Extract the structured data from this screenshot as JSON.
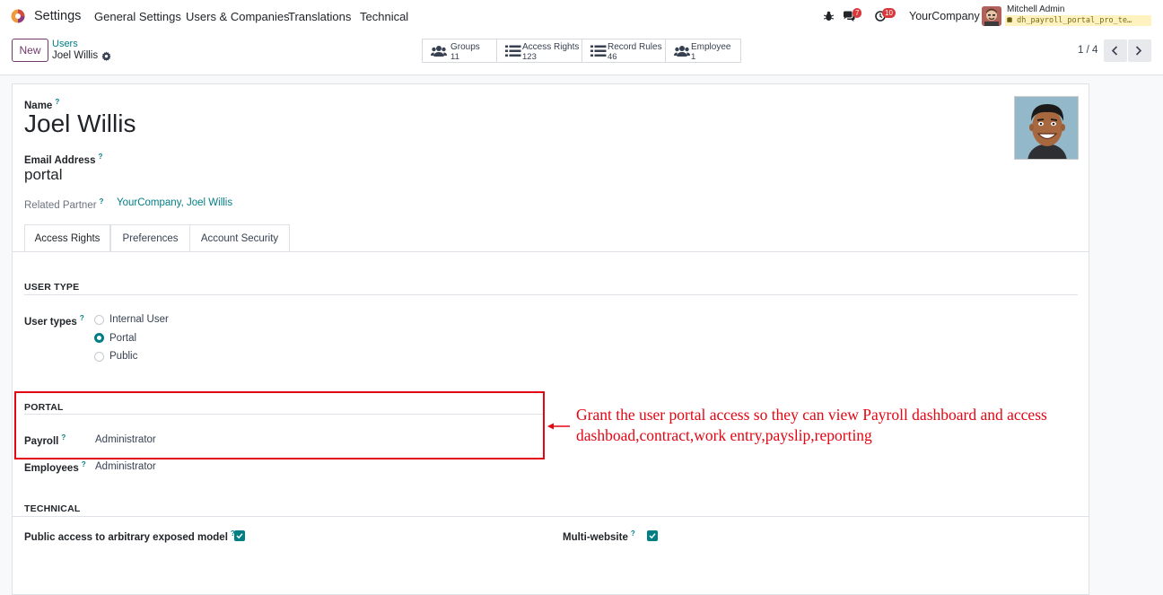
{
  "nav": {
    "app_name": "Settings",
    "menus": [
      "General Settings",
      "Users & Companies",
      "Translations",
      "Technical"
    ],
    "messages_count": "7",
    "activities_count": "10",
    "company": "YourCompany",
    "user_name": "Mitchell Admin",
    "database": "dh_payroll_portal_pro_te…"
  },
  "control": {
    "new_label": "New",
    "breadcrumb_parent": "Users",
    "breadcrumb_current": "Joel Willis",
    "smart_buttons": [
      {
        "label": "Groups",
        "value": "11",
        "icon": "users-icon"
      },
      {
        "label": "Access Rights",
        "value": "123",
        "icon": "list-icon"
      },
      {
        "label": "Record Rules",
        "value": "46",
        "icon": "list-icon"
      },
      {
        "label": "Employee",
        "value": "1",
        "icon": "users-icon"
      }
    ],
    "pager": "1 / 4"
  },
  "form": {
    "name_label": "Name",
    "name_value": "Joel Willis",
    "email_label": "Email Address",
    "email_value": "portal",
    "partner_label": "Related Partner",
    "partner_value": "YourCompany, Joel Willis",
    "tabs": [
      "Access Rights",
      "Preferences",
      "Account Security"
    ],
    "help_mark": "?"
  },
  "user_type": {
    "title": "USER TYPE",
    "label": "User types",
    "options": [
      "Internal User",
      "Portal",
      "Public"
    ],
    "selected": "Portal"
  },
  "portal": {
    "title": "PORTAL",
    "payroll_label": "Payroll",
    "payroll_value": "Administrator",
    "employees_label": "Employees",
    "employees_value": "Administrator"
  },
  "technical": {
    "title": "TECHNICAL",
    "public_access_label": "Public access to arbitrary exposed model",
    "public_access_checked": true,
    "multi_website_label": "Multi-website",
    "multi_website_checked": true
  },
  "annotation": {
    "text": "Grant the user portal access so they can view Payroll dashboard and access dashboad,contract,work entry,payslip,reporting",
    "color": "#e30613"
  },
  "colors": {
    "accent": "#017e84",
    "brand": "#71396a",
    "badge": "#d9383b"
  }
}
